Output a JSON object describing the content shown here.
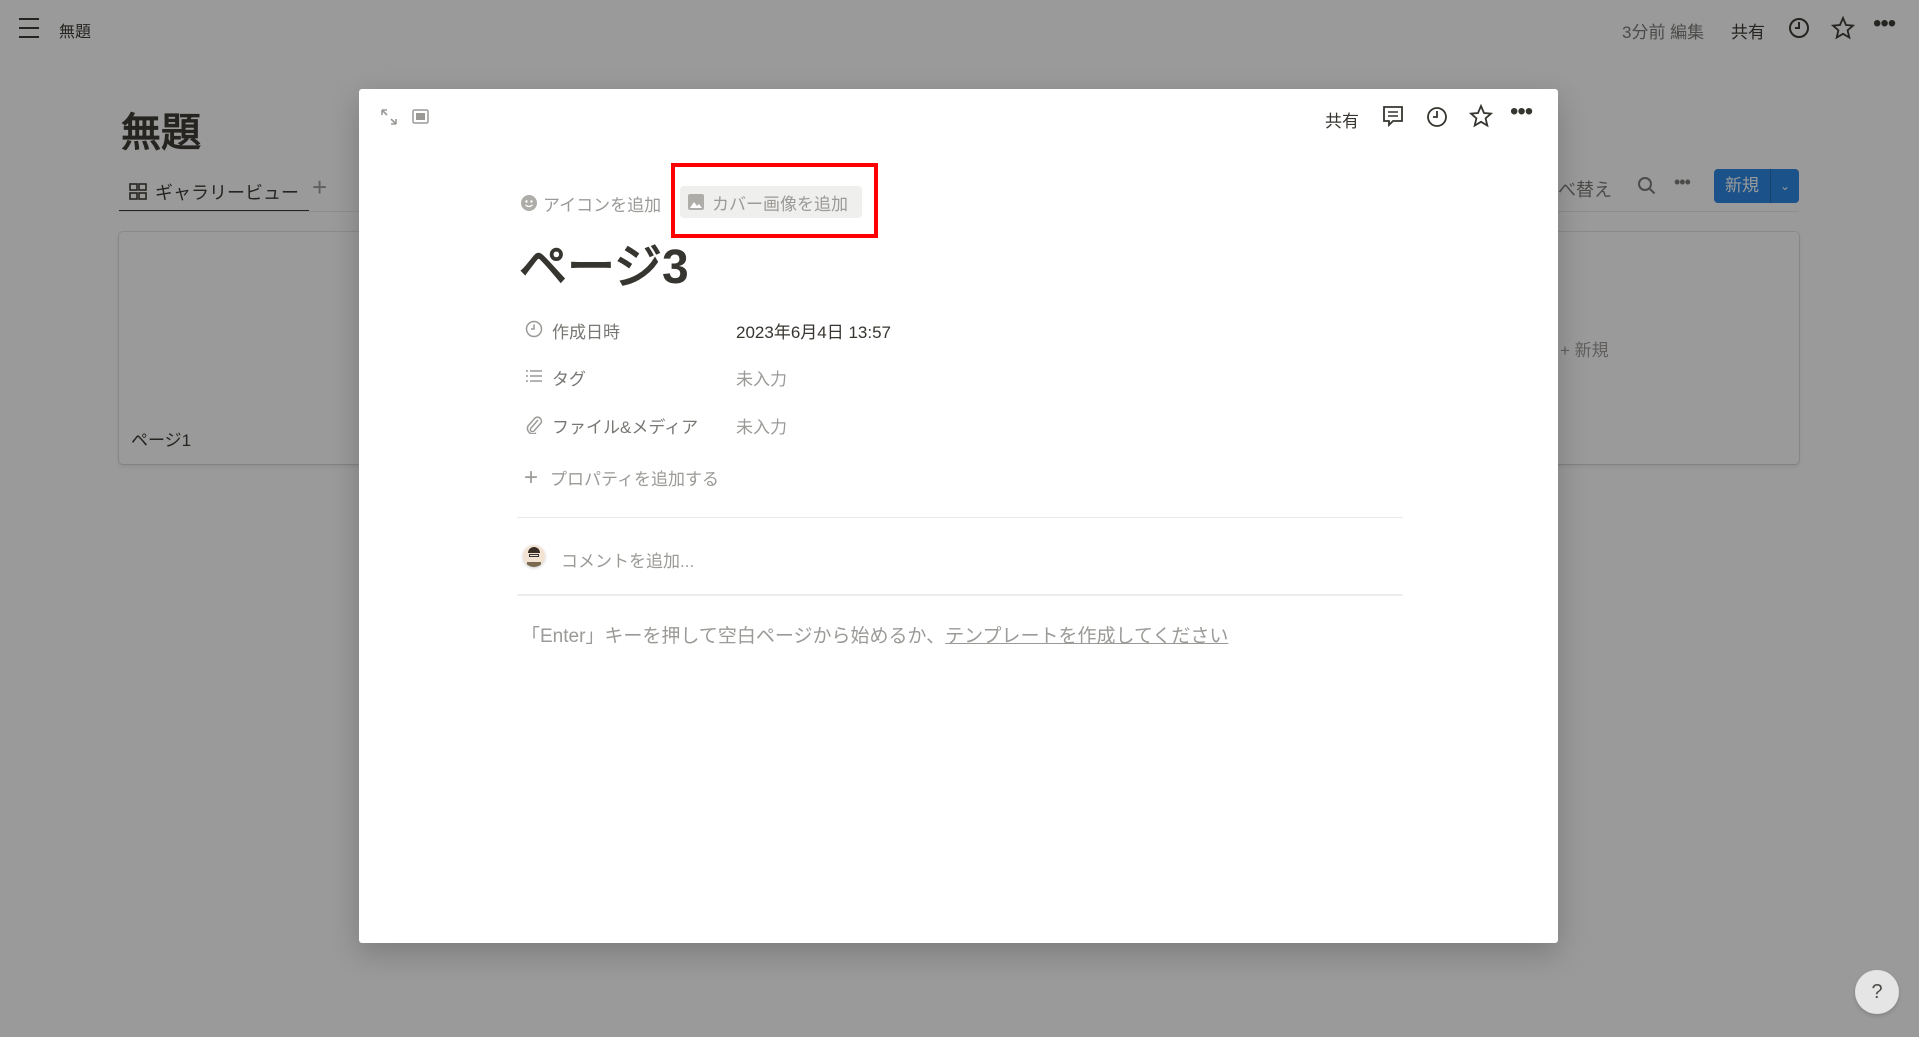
{
  "topbar": {
    "title": "無題",
    "edited": "3分前 編集",
    "share": "共有"
  },
  "database": {
    "title": "無題",
    "view_tab": "ギャラリービュー",
    "sort": "並べ替え",
    "new_button": "新規",
    "cards": [
      {
        "title": "ページ1"
      }
    ],
    "add_new": "新規"
  },
  "modal": {
    "share": "共有",
    "add_icon": "アイコンを追加",
    "add_cover": "カバー画像を追加",
    "page_title": "ページ3",
    "properties": [
      {
        "icon": "clock-icon",
        "label": "作成日時",
        "value": "2023年6月4日 13:57",
        "empty": false
      },
      {
        "icon": "list-icon",
        "label": "タグ",
        "value": "未入力",
        "empty": true
      },
      {
        "icon": "paperclip-icon",
        "label": "ファイル&メディア",
        "value": "未入力",
        "empty": true
      }
    ],
    "add_property": "プロパティを追加する",
    "comment_placeholder": "コメントを追加...",
    "hint_text": "「Enter」キーを押して空白ページから始めるか、",
    "hint_link": "テンプレートを作成してください"
  },
  "help": "?",
  "colors": {
    "highlight": "#ff0000",
    "accent": "#2383e2"
  }
}
